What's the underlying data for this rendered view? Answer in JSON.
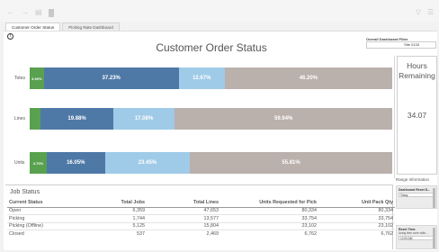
{
  "toolbar": {
    "icons": [
      "arrow-left-icon",
      "arrow-right-icon",
      "sheet-icon",
      "share-icon",
      "filter-icon",
      "menu-icon"
    ]
  },
  "tabs": [
    {
      "label": "Customer Order Status",
      "active": true
    },
    {
      "label": "Picking Rate Dashboard",
      "active": false
    }
  ],
  "chart": {
    "title": "Customer Order Status",
    "colors": {
      "green": "#59a14f",
      "dark_blue": "#4e79a7",
      "light_blue": "#a0cbe8",
      "taupe": "#bab0ac"
    }
  },
  "chart_data": {
    "type": "bar",
    "stacked": true,
    "orientation": "horizontal",
    "normalized": "percent",
    "title": "Customer Order Status",
    "categories": [
      "Totes",
      "Lines",
      "Units"
    ],
    "series": [
      {
        "color": "#59a14f",
        "values": [
          3.9,
          3.1,
          4.7
        ],
        "labels": [
          "3.90%",
          "",
          "4.70%"
        ]
      },
      {
        "color": "#4e79a7",
        "values": [
          37.23,
          19.88,
          16.05
        ],
        "labels": [
          "37.23%",
          "19.88%",
          "16.05%"
        ]
      },
      {
        "color": "#a0cbe8",
        "values": [
          12.67,
          17.08,
          23.45
        ],
        "labels": [
          "12.67%",
          "17.08%",
          "23.45%"
        ]
      },
      {
        "color": "#bab0ac",
        "values": [
          46.2,
          59.94,
          55.81
        ],
        "labels": [
          "46.20%",
          "59.94%",
          "55.81%"
        ]
      }
    ]
  },
  "filter": {
    "title": "Overall Dashboard Filter",
    "value": "Site 0133"
  },
  "hours_panel": {
    "title_line1": "Hours",
    "title_line2": "Remaining",
    "value": "34.07"
  },
  "range_info": "Range Information",
  "reset_date": {
    "title": "Dashboard Reset D...",
    "value": "Today"
  },
  "reset_time": {
    "title": "Reset Time",
    "subtitle": "Using time zone witin...",
    "value": "12:00 AM"
  },
  "job_status": {
    "title": "Job Status",
    "columns": [
      "Current Status",
      "Total Jobs",
      "Total Lines",
      "Units Requested for Pick",
      "Unit Pack Qty"
    ],
    "rows": [
      [
        "Open",
        "6,359",
        "47,653",
        "80,334",
        "80,334"
      ],
      [
        "Picking",
        "1,744",
        "13,577",
        "33,754",
        "33,754"
      ],
      [
        "Picking (Offline)",
        "5,125",
        "15,804",
        "23,102",
        "23,102"
      ],
      [
        "Closed",
        "537",
        "2,469",
        "6,762",
        "6,762"
      ]
    ]
  }
}
